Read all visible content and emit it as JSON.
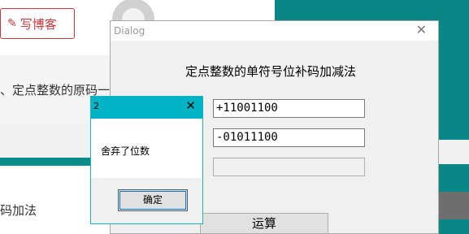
{
  "background": {
    "write_button_label": "写博客",
    "text_line1": "、定点整数的原码一",
    "text_line2": "码加法"
  },
  "dialog": {
    "title": "Dialog",
    "close_glyph": "✕",
    "heading": "定点整数的单符号位补码加减法",
    "field1_value": "+11001100",
    "field2_value": "-01011100",
    "field3_value": "",
    "compute_label": "运算"
  },
  "popup": {
    "title": "2",
    "close_glyph": "✕",
    "message": "舍弃了位数",
    "ok_label": "确定"
  },
  "colors": {
    "teal": "#0b8686",
    "popup_title": "#00b4c5",
    "brand_red": "#d5333a"
  }
}
